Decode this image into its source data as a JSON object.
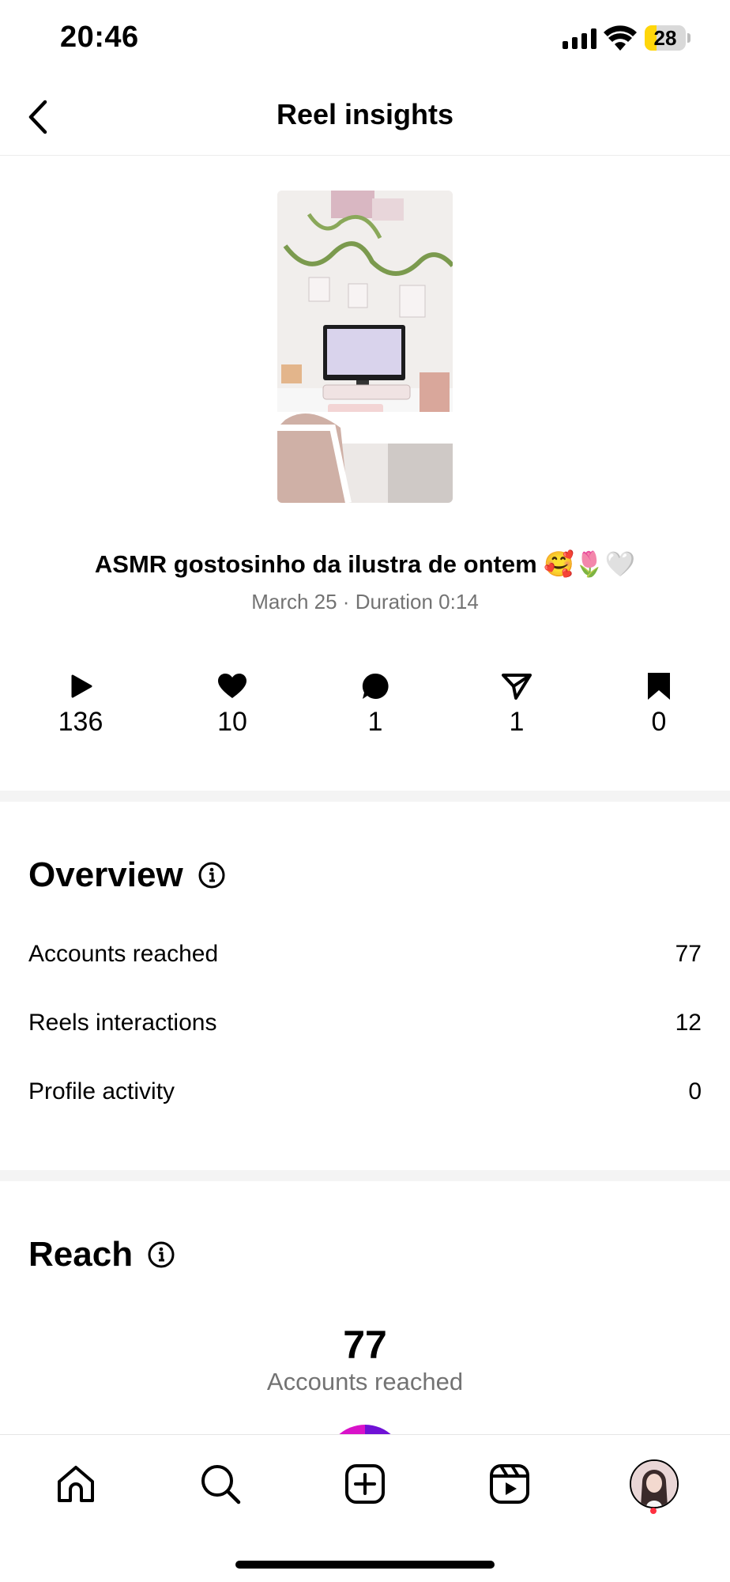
{
  "status_bar": {
    "time": "20:46",
    "battery": "28"
  },
  "header": {
    "title": "Reel insights"
  },
  "reel": {
    "thumbnail_alt": "desk-setup-thumbnail",
    "caption": "ASMR gostosinho da ilustra de ontem 🥰🌷🤍",
    "meta": "March 25 · Duration 0:14"
  },
  "stats": {
    "plays": "136",
    "likes": "10",
    "comments": "1",
    "shares": "1",
    "saves": "0"
  },
  "overview": {
    "title": "Overview",
    "rows": [
      {
        "label": "Accounts reached",
        "value": "77"
      },
      {
        "label": "Reels interactions",
        "value": "12"
      },
      {
        "label": "Profile activity",
        "value": "0"
      }
    ]
  },
  "reach": {
    "title": "Reach",
    "value": "77",
    "label": "Accounts reached"
  },
  "tab_bar": {
    "items": [
      "home-icon",
      "search-icon",
      "create-icon",
      "reels-icon",
      "profile-avatar"
    ]
  },
  "colors": {
    "accent_battery": "#ffd60a",
    "muted_text": "#737373",
    "notification": "#ff3040"
  }
}
